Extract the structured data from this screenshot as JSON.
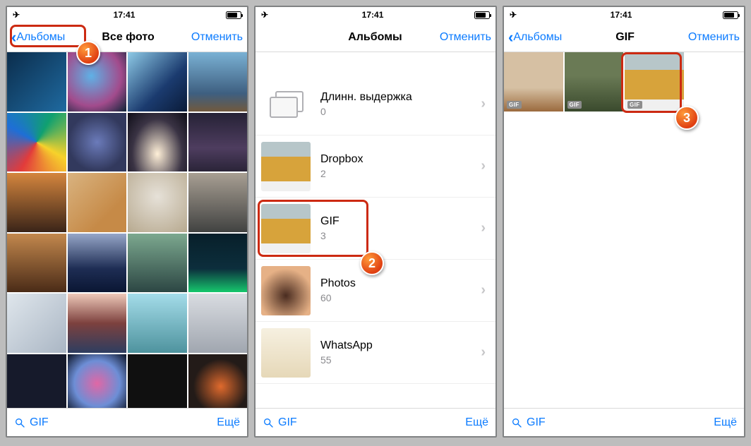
{
  "status": {
    "time": "17:41"
  },
  "common": {
    "cancel_label": "Отменить",
    "search_gif_label": "GIF",
    "more_label": "Ещё",
    "gif_badge": "GIF"
  },
  "screen1": {
    "back_label": "Альбомы",
    "title": "Все фото",
    "step": "1"
  },
  "screen2": {
    "title": "Альбомы",
    "step": "2",
    "albums": [
      {
        "name": "Длинн. выдержка",
        "count": "0"
      },
      {
        "name": "Dropbox",
        "count": "2"
      },
      {
        "name": "GIF",
        "count": "3"
      },
      {
        "name": "Photos",
        "count": "60"
      },
      {
        "name": "WhatsApp",
        "count": "55"
      }
    ]
  },
  "screen3": {
    "back_label": "Альбомы",
    "title": "GIF",
    "step": "3",
    "items": 3
  }
}
